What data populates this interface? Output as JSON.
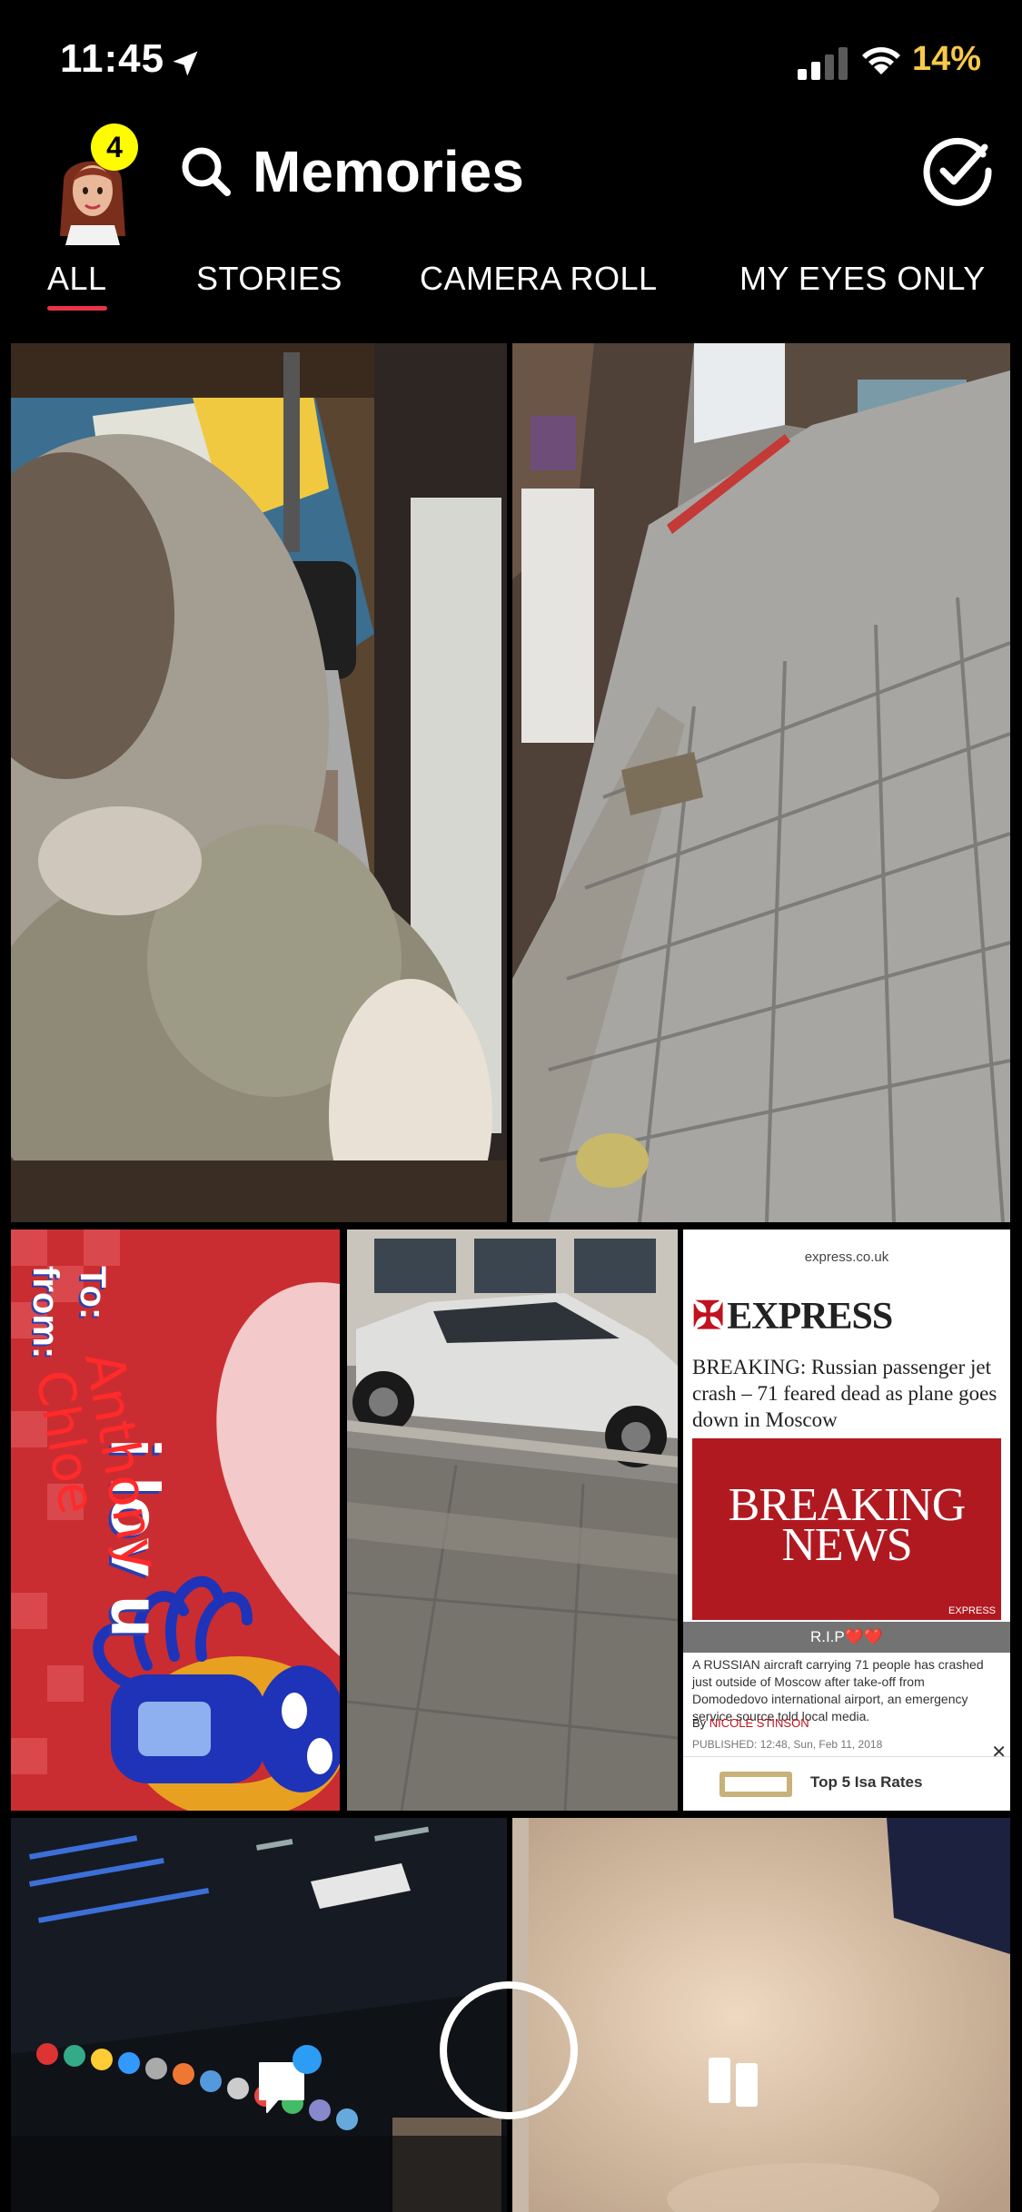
{
  "status_bar": {
    "time": "11:45",
    "battery_percent": "14%",
    "battery_color": "#f7c948"
  },
  "header": {
    "title": "Memories",
    "notification_count": "4",
    "badge_color": "#fffc00"
  },
  "tabs": [
    {
      "label": "ALL",
      "active": true
    },
    {
      "label": "STORIES",
      "active": false
    },
    {
      "label": "CAMERA ROLL",
      "active": false
    },
    {
      "label": "MY EYES ONLY",
      "active": false
    }
  ],
  "accent_color": "#e8334a",
  "memories": {
    "love_card": {
      "to_label": "To:",
      "to_name": "Anthony",
      "from_label": "from:",
      "from_name": "Chloe",
      "message": "i lov u"
    },
    "news_screenshot": {
      "url": "express.co.uk",
      "brand": "EXPRESS",
      "headline": "BREAKING: Russian passenger jet crash – 71 feared dead as plane goes down in Moscow",
      "breaking_line1": "BREAKING",
      "breaking_line2": "NEWS",
      "image_tag": "EXPRESS",
      "caption": "R.I.P❤️❤️",
      "body": "A RUSSIAN aircraft carrying 71 people has crashed just outside of Moscow after take-off from Domodedovo international airport, an emergency service source told local media.",
      "byline_prefix": "By",
      "byline_name": "NICOLE STINSON",
      "published": "PUBLISHED: 12:48, Sun, Feb 11, 2018",
      "ad_text": "Top 5 Isa Rates"
    }
  },
  "icons": {
    "location": "location-arrow-icon",
    "signal": "cellular-signal-icon",
    "wifi": "wifi-icon",
    "search": "search-icon",
    "select": "checkmark-circle-icon",
    "chat": "chat-icon",
    "stories": "stories-icon"
  }
}
